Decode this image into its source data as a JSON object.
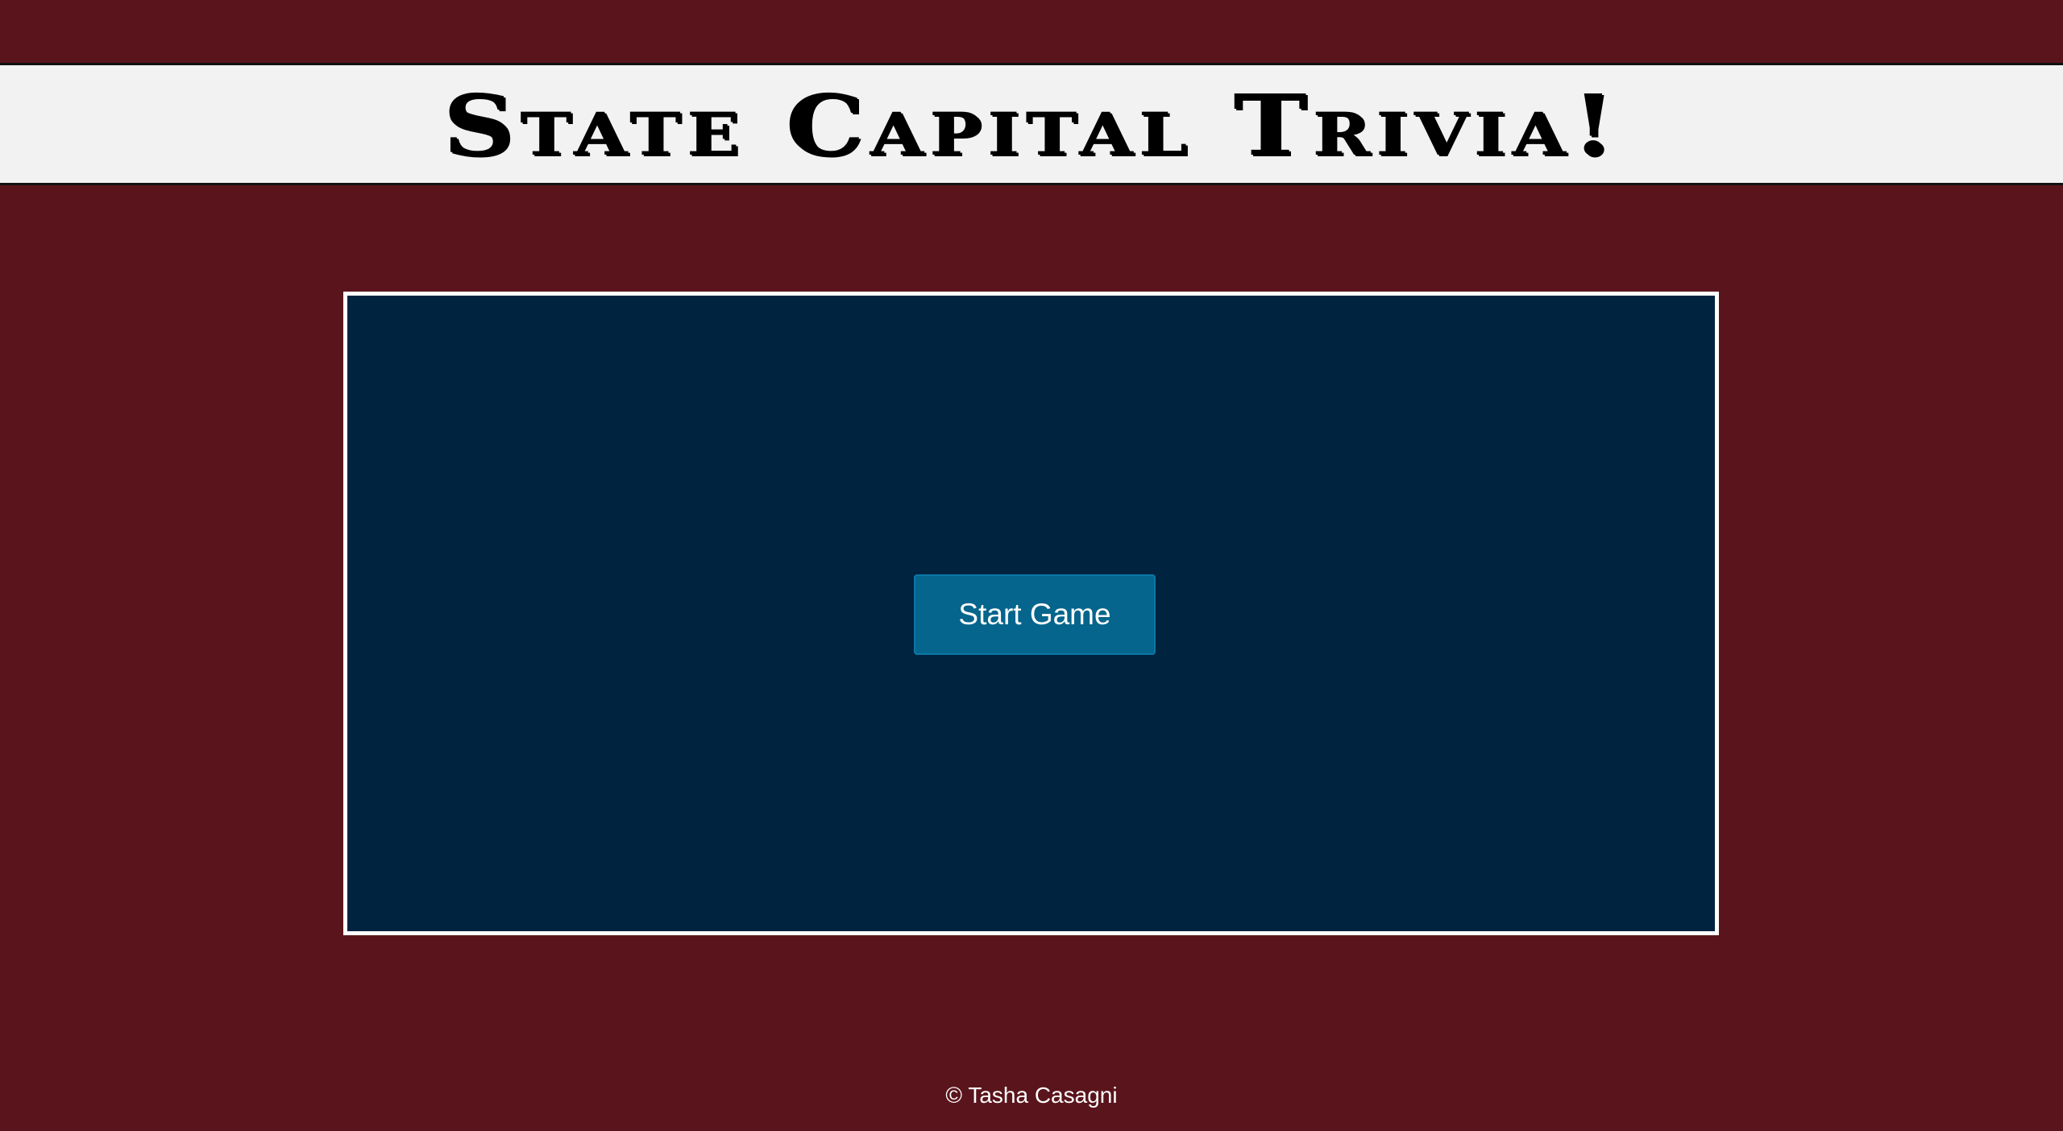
{
  "header": {
    "title": "State Capital Trivia!"
  },
  "game": {
    "start_button_label": "Start Game"
  },
  "footer": {
    "copyright": "© Tasha Casagni"
  },
  "colors": {
    "page_background": "#5a151c",
    "header_background": "#f2f2f2",
    "panel_background": "#00233f",
    "panel_border": "#ffffff",
    "button_background": "#05658c",
    "text_light": "#ffffff"
  }
}
